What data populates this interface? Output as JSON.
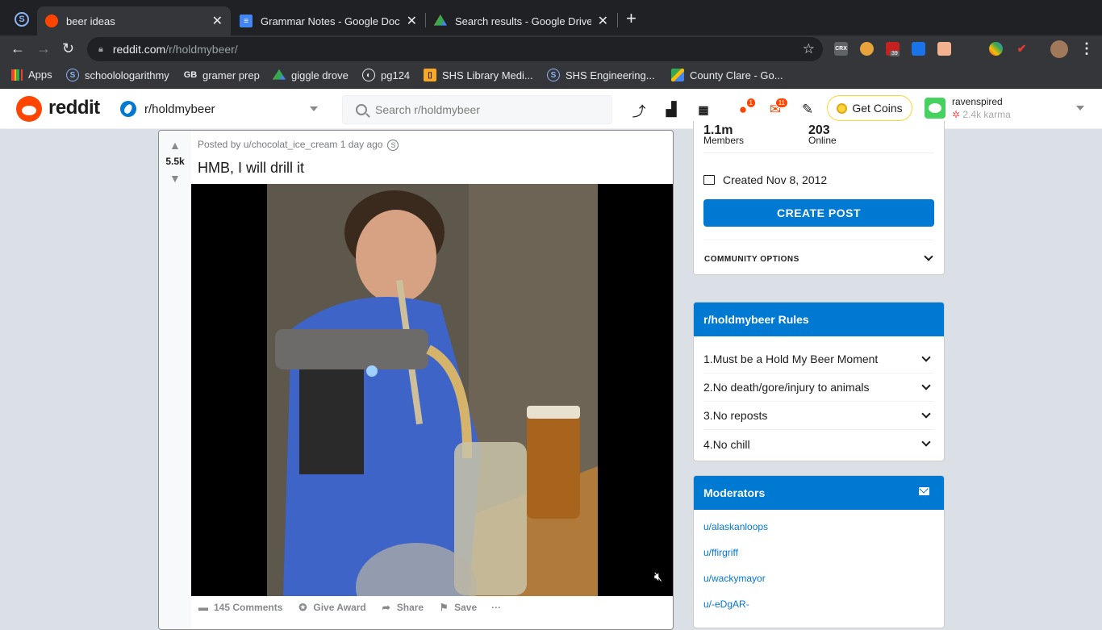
{
  "browser": {
    "tabs": [
      {
        "title": "beer ideas",
        "active": true
      },
      {
        "title": "Grammar Notes - Google Docs",
        "active": false
      },
      {
        "title": "Search results - Google Drive",
        "active": false
      }
    ],
    "url_host": "reddit.com",
    "url_path": "/r/holdmybeer/",
    "extensions": [
      "CRX",
      "39"
    ],
    "bookmarks": [
      {
        "label": "Apps",
        "icon": "apps-grid-icon"
      },
      {
        "label": "schoolologarithmy",
        "icon": "schoology-icon"
      },
      {
        "label": "gramer prep",
        "icon": "gb-icon"
      },
      {
        "label": "giggle drove",
        "icon": "google-drive-icon"
      },
      {
        "label": "pg124",
        "icon": "globe-icon"
      },
      {
        "label": "SHS Library Medi...",
        "icon": "bookmark-icon"
      },
      {
        "label": "SHS Engineering...",
        "icon": "schoology-icon"
      },
      {
        "label": "County Clare - Go...",
        "icon": "google-maps-icon"
      }
    ]
  },
  "reddit": {
    "logo_text": "reddit",
    "community": "r/holdmybeer",
    "search_placeholder": "Search r/holdmybeer",
    "chat_badge": "1",
    "inbox_badge": "11",
    "get_coins": "Get Coins",
    "username": "ravenspired",
    "karma": "2.4k karma"
  },
  "post": {
    "score": "5.5k",
    "posted_by": "Posted by u/chocolat_ice_cream 1 day ago",
    "title": "HMB, I will drill it",
    "comments": "145 Comments",
    "give_award": "Give Award",
    "share": "Share",
    "save": "Save",
    "more": "···"
  },
  "sidebar": {
    "members_label": "Members",
    "online_label": "Online",
    "created": "Created Nov 8, 2012",
    "create_post": "CREATE POST",
    "community_options": "COMMUNITY OPTIONS",
    "rules_title": "r/holdmybeer Rules",
    "rules": [
      {
        "num": "1.",
        "text": "Must be a Hold My Beer Moment"
      },
      {
        "num": "2.",
        "text": "No death/gore/injury to animals"
      },
      {
        "num": "3.",
        "text": "No reposts"
      },
      {
        "num": "4.",
        "text": "No chill"
      }
    ],
    "moderators_title": "Moderators",
    "moderators": [
      "u/alaskanloops",
      "u/ffirgriff",
      "u/wackymayor",
      "u/-eDgAR-"
    ]
  },
  "colors": {
    "reddit_orange": "#ff4500",
    "reddit_blue": "#0079d3",
    "page_bg": "#dae0e6",
    "chrome_dark": "#202124",
    "chrome_toolbar": "#35363a"
  }
}
